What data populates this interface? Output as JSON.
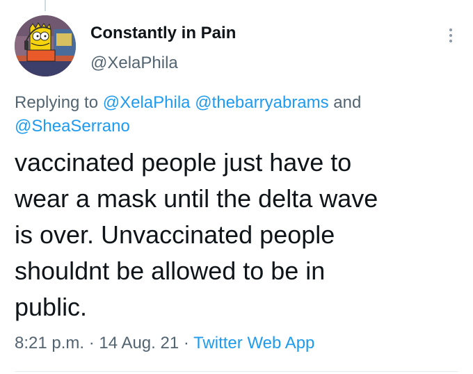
{
  "author": {
    "display_name": "Constantly in Pain",
    "handle": "@XelaPhila",
    "avatar_icon": "bart-simpson-avatar"
  },
  "reply_context": {
    "prefix": "Replying to",
    "mentions": [
      "@XelaPhila",
      "@thebarryabrams",
      "@SheaSerrano"
    ],
    "conjunction": "and"
  },
  "tweet": {
    "text": "vaccinated people just have to\nwear a mask until the delta wave\nis over. Unvaccinated people\nshouldnt be allowed to be in\npublic."
  },
  "meta": {
    "time": "8:21 p.m.",
    "separator": "·",
    "date": "14 Aug. 21",
    "source": "Twitter Web App"
  },
  "colors": {
    "text_primary": "#0f1419",
    "text_secondary": "#536471",
    "link": "#1d9bf0"
  }
}
